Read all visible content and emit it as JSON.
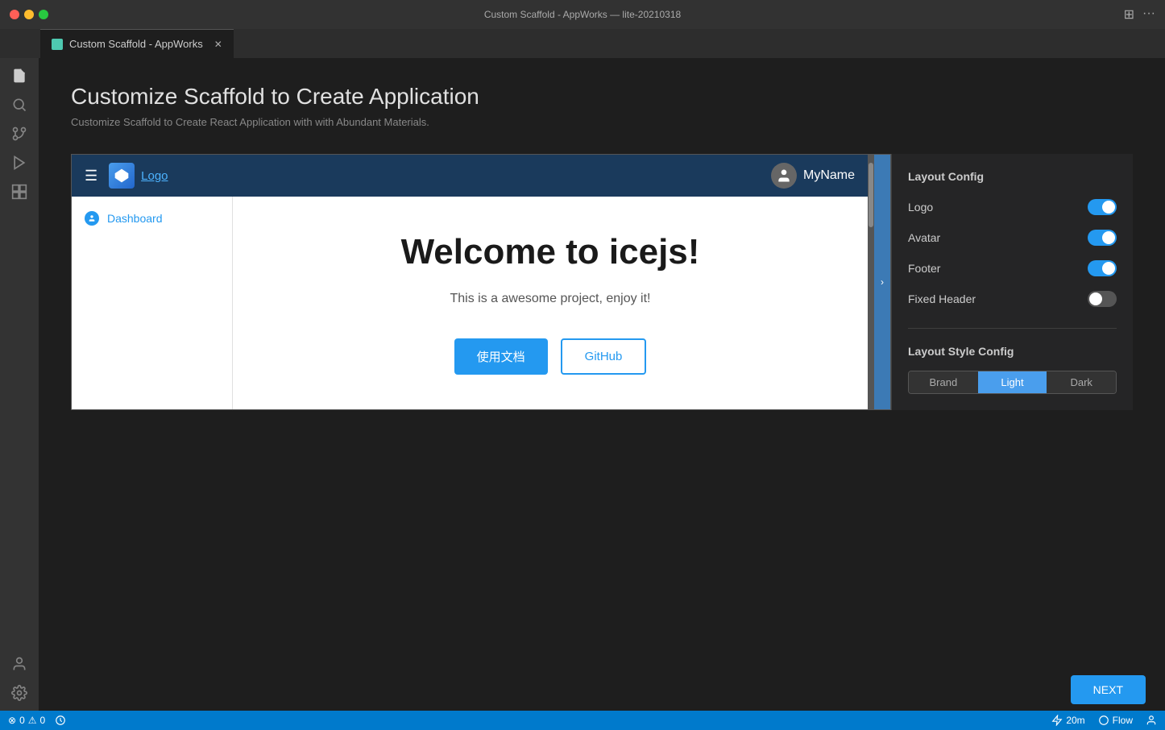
{
  "titlebar": {
    "title": "Custom Scaffold - AppWorks — lite-20210318",
    "tab_label": "Custom Scaffold - AppWorks"
  },
  "activity_bar": {
    "icons": [
      "files-icon",
      "search-icon",
      "source-control-icon",
      "run-icon",
      "extensions-icon"
    ],
    "bottom_icons": [
      "account-icon",
      "settings-icon"
    ]
  },
  "page": {
    "title": "Customize Scaffold to Create Application",
    "subtitle": "Customize Scaffold to Create React Application with with Abundant Materials."
  },
  "preview": {
    "header": {
      "menu_label": "☰",
      "logo_text": "Logo",
      "avatar_name": "MyName"
    },
    "sidebar": {
      "item_label": "Dashboard"
    },
    "main": {
      "welcome_title": "Welcome to icejs!",
      "welcome_subtitle": "This is a awesome project, enjoy it!",
      "btn_primary": "使用文档",
      "btn_secondary": "GitHub"
    }
  },
  "layout_config": {
    "section_title": "Layout Config",
    "items": [
      {
        "label": "Logo",
        "toggle_state": "on"
      },
      {
        "label": "Avatar",
        "toggle_state": "on"
      },
      {
        "label": "Footer",
        "toggle_state": "on"
      },
      {
        "label": "Fixed Header",
        "toggle_state": "off"
      }
    ]
  },
  "layout_style_config": {
    "section_title": "Layout Style Config",
    "options": [
      "Brand",
      "Light",
      "Dark"
    ],
    "active": "Light"
  },
  "status_bar": {
    "errors": "0",
    "warnings": "0",
    "time": "20m",
    "flow": "Flow"
  },
  "next_button": {
    "label": "NEXT"
  }
}
